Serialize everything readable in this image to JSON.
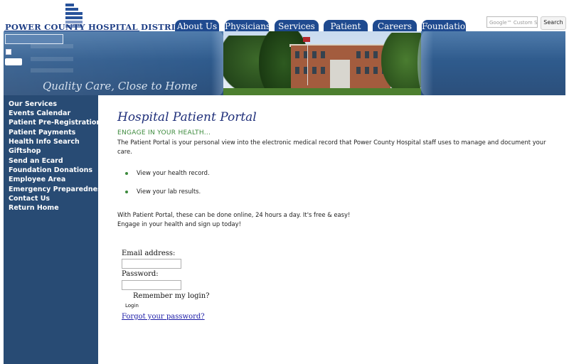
{
  "header": {
    "logo_text": "POWER COUNTY HOSPITAL DISTRICT",
    "tabs": [
      {
        "label": "About Us"
      },
      {
        "label": "Physicians"
      },
      {
        "label": "Services"
      },
      {
        "label": "Patient Info"
      },
      {
        "label": "Careers"
      },
      {
        "label": "Foundation"
      }
    ],
    "search": {
      "placeholder": "Google™ Custom Search",
      "button_label": "Search"
    }
  },
  "banner": {
    "tagline": "Quality Care, Close to Home"
  },
  "sidebar": {
    "items": [
      {
        "label": "Our Services"
      },
      {
        "label": "Events Calendar"
      },
      {
        "label": "Patient Pre-Registration"
      },
      {
        "label": "Patient Payments"
      },
      {
        "label": "Health Info Search"
      },
      {
        "label": "Giftshop"
      },
      {
        "label": "Send an Ecard"
      },
      {
        "label": "Foundation Donations"
      },
      {
        "label": "Employee Area"
      },
      {
        "label": "Emergency Preparedness"
      },
      {
        "label": "Contact Us"
      },
      {
        "label": "Return Home"
      }
    ]
  },
  "main": {
    "title": "Hospital Patient Portal",
    "subhead": "ENGAGE IN YOUR HEALTH...",
    "intro_line1": "The Patient Portal is your personal view into the electronic medical record that Power County Hospital staff uses to manage and document your",
    "intro_line2": "care.",
    "bullets": [
      "View your health record.",
      "View your lab results."
    ],
    "closing_line1": "With Patient Portal, these can be done online, 24 hours a day. It's free & easy!",
    "closing_line2": "Engage in your health and sign up today!"
  },
  "login_form": {
    "email_label": "Email address:",
    "email_value": "",
    "password_label": "Password:",
    "password_value": "",
    "remember_label": "Remember my login?",
    "login_button": "Login",
    "forgot_link": "Forgot your password?"
  },
  "colors": {
    "nav_tab": "#1f4a8f",
    "sidebar_bg": "#284b74",
    "title": "#1f2f7a",
    "subhead": "#3c8a3c",
    "link": "#1a1aa6"
  }
}
